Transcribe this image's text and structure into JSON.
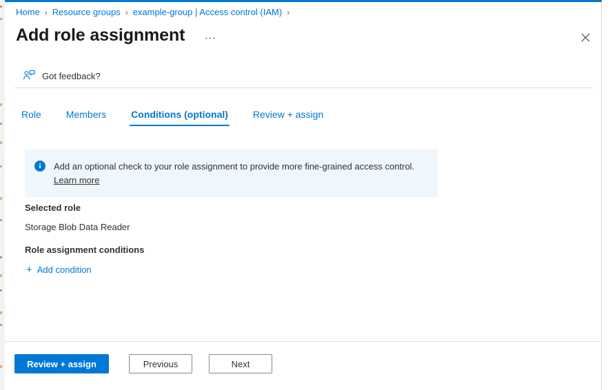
{
  "breadcrumb": {
    "items": [
      {
        "label": "Home"
      },
      {
        "label": "Resource groups"
      },
      {
        "label": "example-group | Access control (IAM)"
      }
    ],
    "separator": "›"
  },
  "header": {
    "title": "Add role assignment",
    "more_actions": "···",
    "close_icon": "close-icon"
  },
  "feedback": {
    "label": "Got feedback?",
    "icon": "feedback-person-icon"
  },
  "tabs": [
    {
      "label": "Role",
      "active": false
    },
    {
      "label": "Members",
      "active": false
    },
    {
      "label": "Conditions (optional)",
      "active": true
    },
    {
      "label": "Review + assign",
      "active": false
    }
  ],
  "info_banner": {
    "icon": "info-icon",
    "glyph": "i",
    "text": "Add an optional check to your role assignment to provide more fine-grained access control. ",
    "link_text": "Learn more"
  },
  "content": {
    "selected_role_heading": "Selected role",
    "selected_role_value": "Storage Blob Data Reader",
    "conditions_heading": "Role assignment conditions",
    "add_condition_label": "Add condition",
    "add_condition_plus": "+"
  },
  "footer": {
    "primary_label": "Review + assign",
    "previous_label": "Previous",
    "next_label": "Next"
  },
  "colors": {
    "accent": "#0078d4",
    "banner_bg": "#eff6fc",
    "text": "#323130",
    "divider": "#e1dfdd",
    "border": "#8a8886"
  }
}
